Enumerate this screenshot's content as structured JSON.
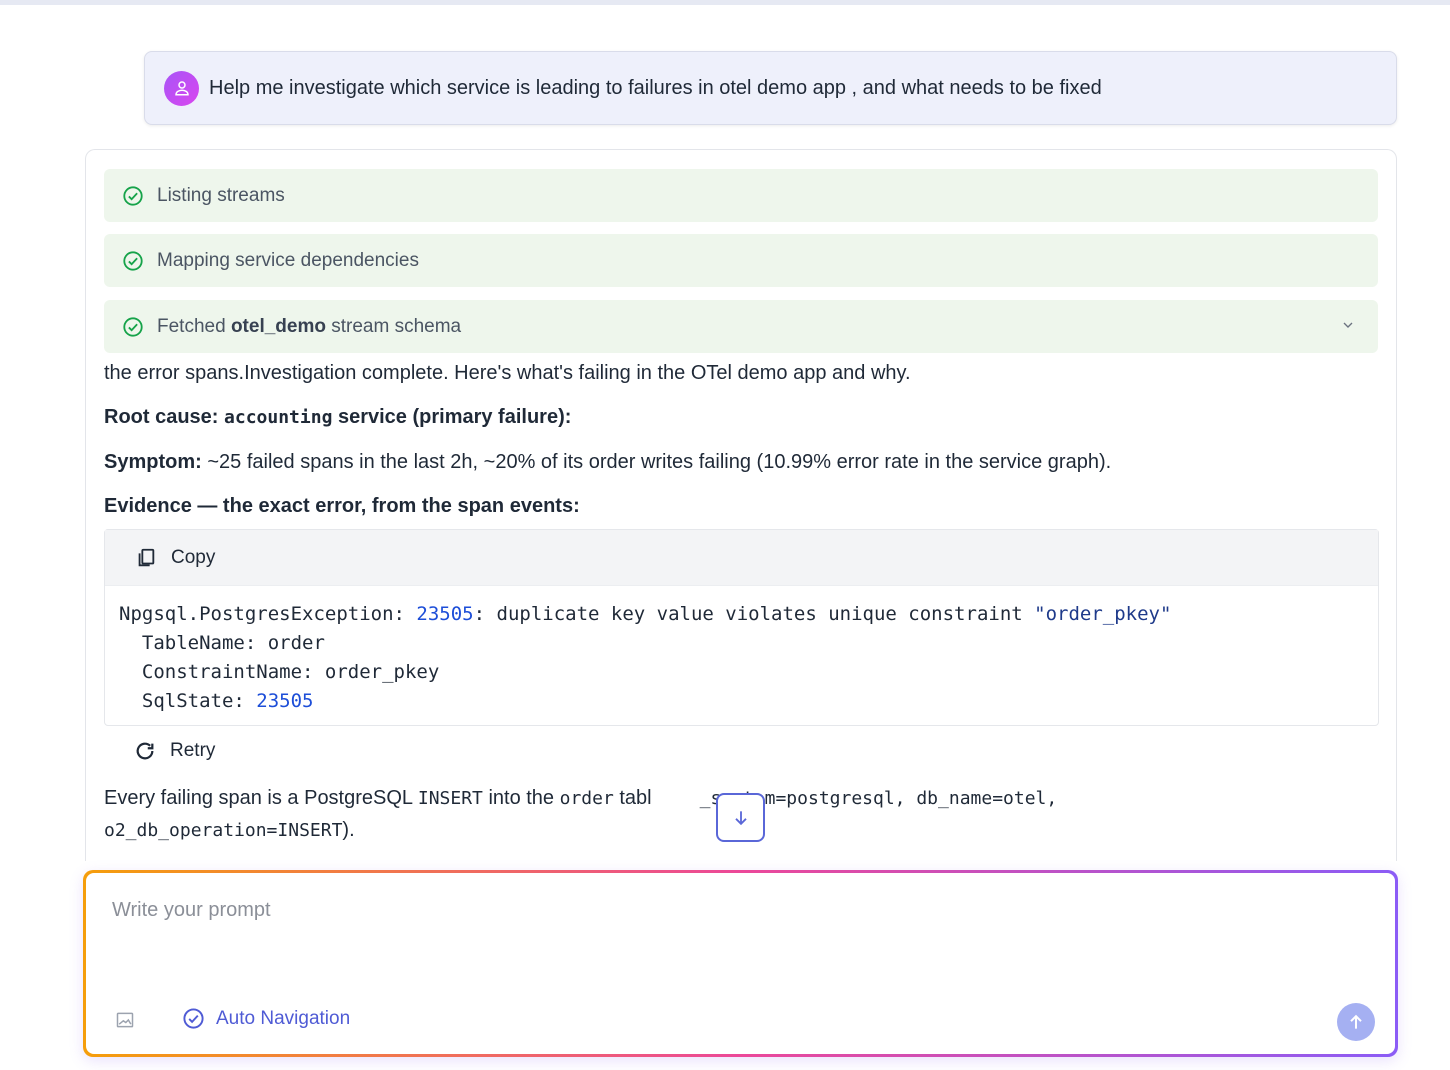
{
  "user_message": {
    "text": "Help me investigate which service is leading to failures in otel demo app , and what needs to be fixed"
  },
  "steps": [
    {
      "label": "Listing streams"
    },
    {
      "label": "Mapping service dependencies"
    },
    {
      "label_prefix": "Fetched ",
      "label_bold": "otel_demo",
      "label_suffix": " stream schema"
    }
  ],
  "response": {
    "intro": "the error spans.Investigation complete. Here's what's failing in the OTel demo app and why.",
    "root_cause_prefix": "Root cause: ",
    "root_cause_service": "accounting",
    "root_cause_suffix": " service (primary failure):",
    "symptom_label": "Symptom:",
    "symptom_text": " ~25 failed spans in the last 2h, ~20% of its order writes failing (10.99% error rate in the service graph).",
    "evidence_heading": "Evidence — the exact error, from the span events:",
    "copy_label": "Copy",
    "code": {
      "l1_a": "Npgsql.PostgresException: ",
      "l1_num": "23505",
      "l1_b": ": duplicate key value violates unique constraint ",
      "l1_str": "\"order_pkey\"",
      "l2": "  TableName: order",
      "l3": "  ConstraintName: order_pkey",
      "l4_a": "  SqlState: ",
      "l4_num": "23505"
    },
    "retry_label": "Retry",
    "last_a": "Every failing span is a PostgreSQL ",
    "last_insert": "INSERT",
    "last_b": " into the ",
    "last_order": "order",
    "last_c": " tabl",
    "last_d": "_system=postgresql, db_name=otel,",
    "last_line2_mono": "o2_db_operation=INSERT",
    "last_line2_end": ")."
  },
  "prompt": {
    "placeholder": "Write your prompt",
    "auto_navigation_label": "Auto Navigation"
  },
  "colors": {
    "accent": "#4f5bd5",
    "step_bg": "#eef6ec",
    "check_green": "#16a34a"
  },
  "icons": {
    "avatar": "user-icon",
    "step": "check-circle-icon",
    "copy": "copy-icon",
    "retry": "refresh-icon",
    "scroll": "arrow-down-icon",
    "image": "image-icon",
    "auto_nav": "check-circle-icon",
    "send": "arrow-up-icon"
  }
}
